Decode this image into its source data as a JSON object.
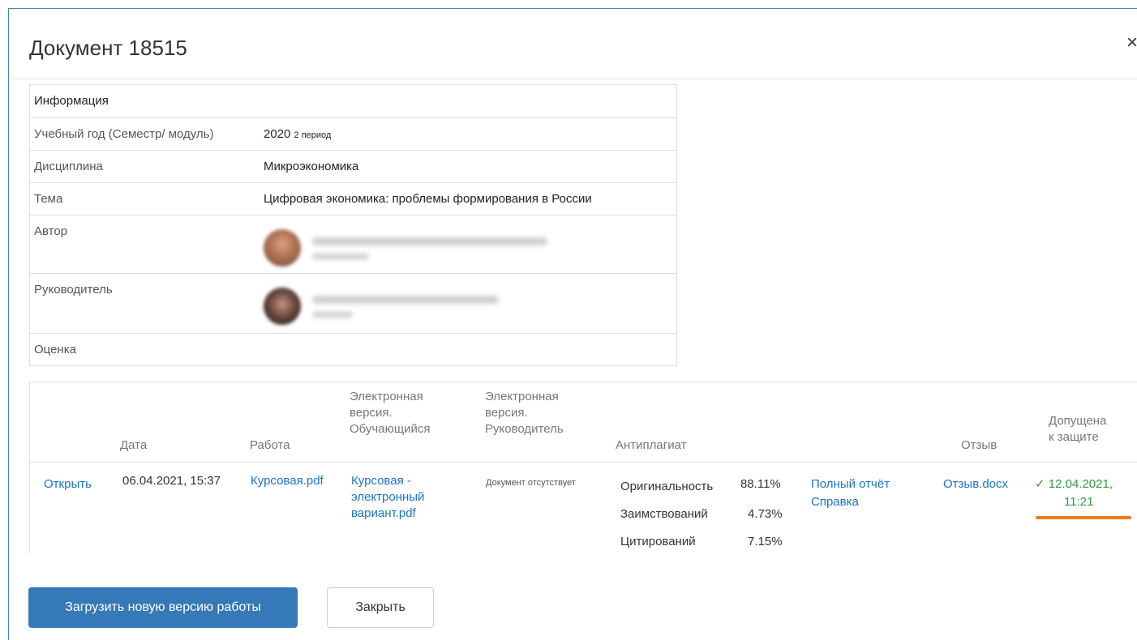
{
  "modal": {
    "title": "Документ 18515",
    "close_icon": "×"
  },
  "info": {
    "header": "Информация",
    "rows": [
      {
        "label": "Учебный год (Семестр/ модуль)",
        "value": "2020",
        "value_small": "2 период"
      },
      {
        "label": "Дисциплина",
        "value": "Микроэкономика"
      },
      {
        "label": "Тема",
        "value": "Цифровая экономика: проблемы формирования в России"
      },
      {
        "label": "Автор"
      },
      {
        "label": "Руководитель"
      },
      {
        "label": "Оценка",
        "value": ""
      }
    ]
  },
  "files": {
    "columns": {
      "date": "Дата",
      "work": "Работа",
      "student_version": [
        "Электронная",
        "версия.",
        "Обучающийся"
      ],
      "supervisor_version": [
        "Электронная",
        "версия.",
        "Руководитель"
      ],
      "antiplagiat": "Антиплагиат",
      "review": "Отзыв",
      "admitted": [
        "Допущена",
        "к защите"
      ]
    },
    "row": {
      "open": "Открыть",
      "date": "06.04.2021, 15:37",
      "work_file": "Курсовая.pdf",
      "student_file": [
        "Курсовая -",
        "электронный",
        "вариант.pdf"
      ],
      "supervisor_file": "Документ отсутствует",
      "metrics": [
        {
          "label": "Оригинальность",
          "value": "88.11%"
        },
        {
          "label": "Заимствований",
          "value": "4.73%"
        },
        {
          "label": "Цитирований",
          "value": "7.15%"
        }
      ],
      "full_report": "Полный отчёт",
      "certificate": "Справка",
      "review_file": "Отзыв.docx",
      "admitted_check": "✓",
      "admitted_date": "12.04.2021,",
      "admitted_time": "11:21"
    }
  },
  "buttons": {
    "upload": "Загрузить новую версию работы",
    "close": "Закрыть"
  },
  "colors": {
    "link": "#1a73c7",
    "primary": "#3579b8",
    "success": "#2e9a3c",
    "highlight": "#f07a1e"
  }
}
